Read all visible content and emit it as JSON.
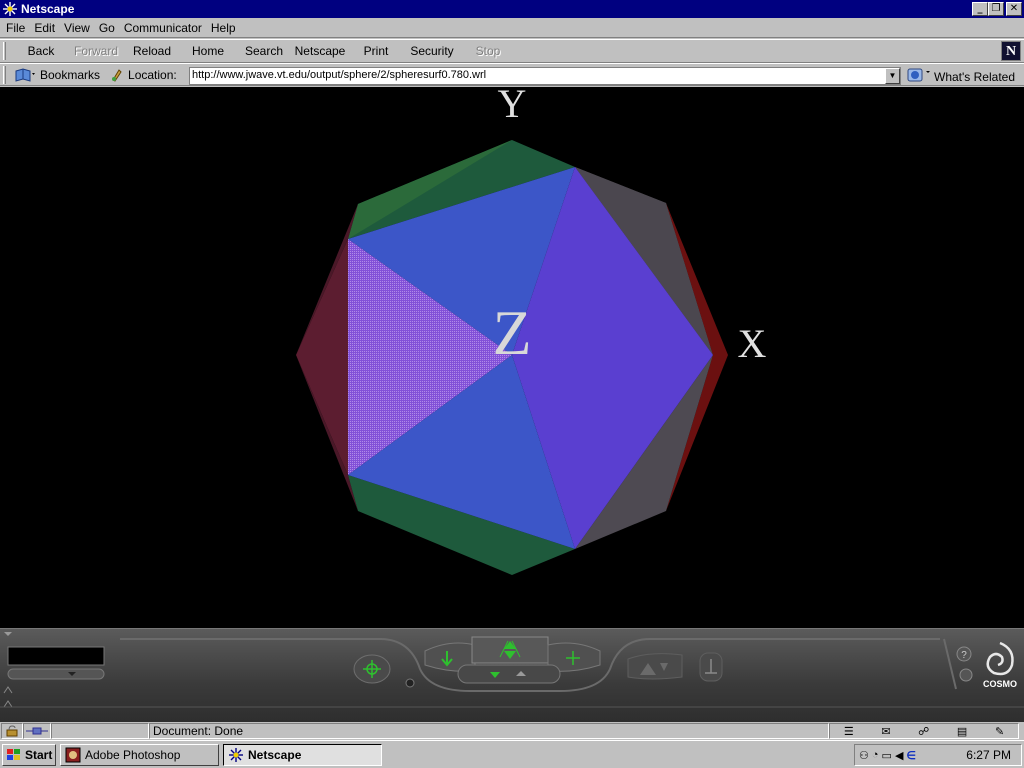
{
  "window": {
    "title": "Netscape"
  },
  "menu": [
    {
      "id": "file",
      "label": "File"
    },
    {
      "id": "edit",
      "label": "Edit"
    },
    {
      "id": "view",
      "label": "View"
    },
    {
      "id": "go",
      "label": "Go"
    },
    {
      "id": "communicator",
      "label": "Communicator"
    },
    {
      "id": "help",
      "label": "Help"
    }
  ],
  "nav": {
    "back": "Back",
    "forward": "Forward",
    "reload": "Reload",
    "home": "Home",
    "search": "Search",
    "netscape": "Netscape",
    "print": "Print",
    "security": "Security",
    "stop": "Stop",
    "logo": "N"
  },
  "location": {
    "bookmarks": "Bookmarks",
    "label": "Location:",
    "url": "http://www.jwave.vt.edu/output/sphere/2/spheresurf0.780.wrl",
    "related": "What's Related"
  },
  "scene": {
    "axis_y": "Y",
    "axis_x": "X",
    "axis_z": "Z",
    "colors": {
      "blue": "#3c56c8",
      "violet": "#5a3fd0",
      "purple": "#7a4fd8",
      "green": "#1e5a3c",
      "maroon": "#5c1d30",
      "gray": "#4e4a52",
      "darkred": "#6b1010"
    }
  },
  "console": {
    "brand": "COSMO",
    "help": "?"
  },
  "status": {
    "text": "Document: Done"
  },
  "taskbar": {
    "start": "Start",
    "tasks": [
      {
        "label": "Adobe Photoshop"
      },
      {
        "label": "Netscape"
      }
    ],
    "clock": "6:27 PM"
  }
}
